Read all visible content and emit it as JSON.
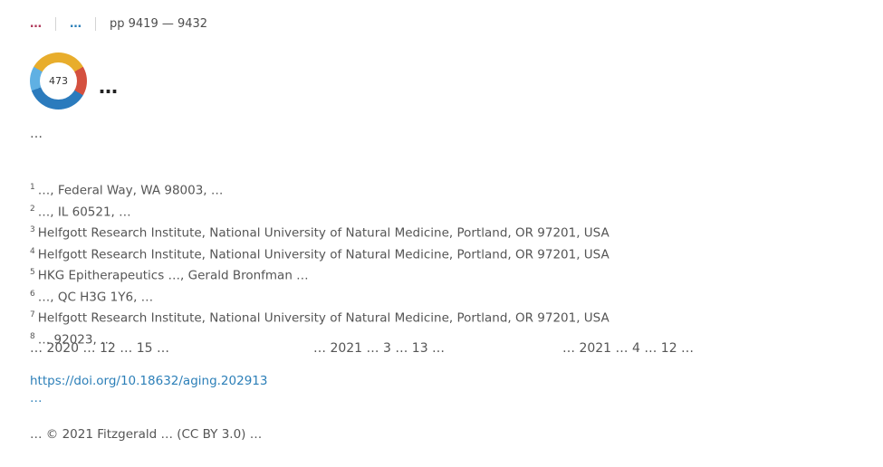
{
  "meta": {
    "article_type": "…",
    "volume_issue": "…",
    "pages": "pp 9419 — 9432"
  },
  "badge": {
    "score": "473"
  },
  "title": "…",
  "authors": "…",
  "affiliations": [
    {
      "num": "1",
      "text": "…, Federal Way, WA 98003, …"
    },
    {
      "num": "2",
      "text": "…, IL 60521, …"
    },
    {
      "num": "3",
      "text": "Helfgott Research Institute, National University of Natural Medicine, Portland, OR 97201, USA"
    },
    {
      "num": "4",
      "text": "Helfgott Research Institute, National University of Natural Medicine, Portland, OR 97201, USA"
    },
    {
      "num": "5",
      "text": "HKG Epitherapeutics …, Gerald Bronfman …"
    },
    {
      "num": "6",
      "text": "…, QC H3G 1Y6, …"
    },
    {
      "num": "7",
      "text": "Helfgott Research Institute, National University of Natural Medicine, Portland, OR 97201, USA"
    },
    {
      "num": "8",
      "text": "… 92023, …"
    }
  ],
  "dates": {
    "received": "… 2020 … 12 … 15 …",
    "accepted": "… 2021 … 3 … 13 …",
    "published": "… 2021 … 4 … 12 …"
  },
  "doi": "https://doi.org/10.18632/aging.202913",
  "cite_label": "…",
  "copyright": "… © 2021 Fitzgerald … (CC BY 3.0) …"
}
